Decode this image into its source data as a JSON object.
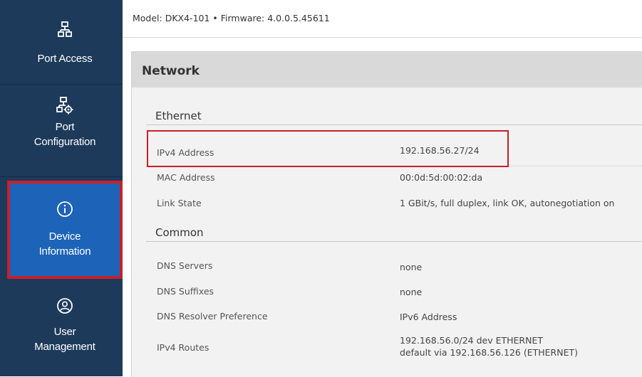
{
  "sidebar": {
    "items": [
      {
        "label": "Port Access",
        "icon": "network-icon"
      },
      {
        "label": "Port Configuration",
        "label_lines": [
          "Port",
          "Configuration"
        ],
        "icon": "network-settings-icon"
      },
      {
        "label": "Device Information",
        "label_lines": [
          "Device",
          "Information"
        ],
        "icon": "info-icon",
        "active": true
      },
      {
        "label": "User Management",
        "label_lines": [
          "User",
          "Management"
        ],
        "icon": "user-icon"
      }
    ]
  },
  "header": {
    "model_text": "Model: DKX4-101  •  Firmware: 4.0.0.5.45611"
  },
  "panel": {
    "title": "Network",
    "sections": [
      {
        "title": "Ethernet",
        "rows": [
          {
            "label": "IPv4 Address",
            "value": "192.168.56.27/24"
          },
          {
            "label": "MAC Address",
            "value": "00:0d:5d:00:02:da"
          },
          {
            "label": "Link State",
            "value": "1 GBit/s, full duplex, link OK, autonegotiation on"
          }
        ]
      },
      {
        "title": "Common",
        "rows": [
          {
            "label": "DNS Servers",
            "value": "none"
          },
          {
            "label": "DNS Suffixes",
            "value": "none"
          },
          {
            "label": "DNS Resolver Preference",
            "value": "IPv6 Address"
          },
          {
            "label": "IPv4 Routes",
            "value_lines": [
              "192.168.56.0/24 dev ETHERNET",
              "default via 192.168.56.126 (ETHERNET)"
            ]
          }
        ]
      }
    ]
  },
  "colors": {
    "sidebar_bg": "#1d3a5b",
    "active_bg": "#1d63b8",
    "highlight": "#c8202a",
    "panel_bg": "#f2f2f2",
    "panel_header_bg": "#d9d9d9"
  }
}
